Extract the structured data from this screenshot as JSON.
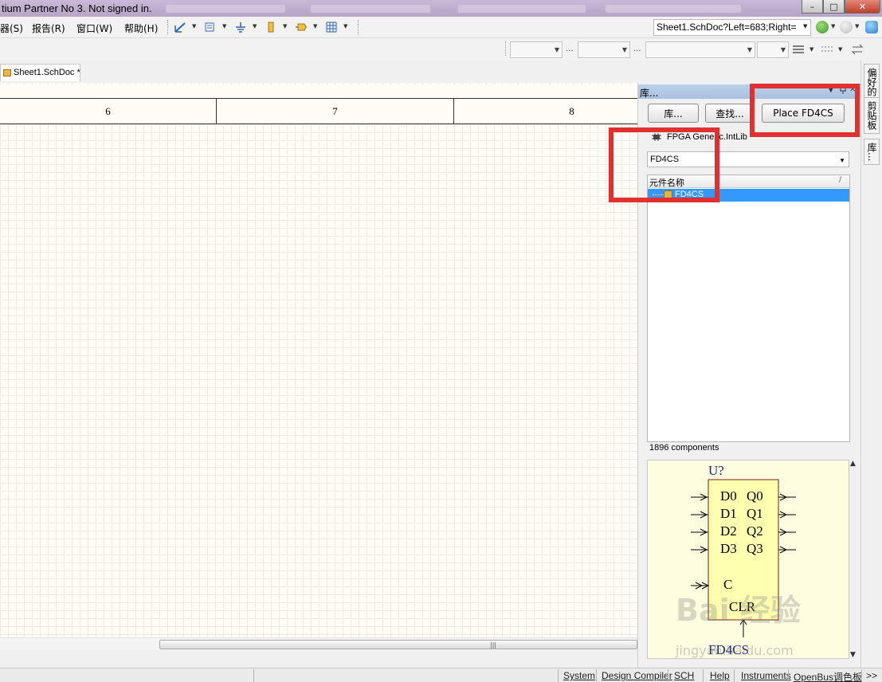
{
  "window": {
    "title": "tium Partner No 3. Not signed in.",
    "min_glyph": "–",
    "max_glyph": "□",
    "close_glyph": "✕"
  },
  "menu": {
    "items": [
      "器(S)",
      "报告(R)",
      "窗口(W)",
      "帮助(H)"
    ]
  },
  "address": {
    "value": "Sheet1.SchDoc?Left=683;Right="
  },
  "toolbar2": {
    "ellipsis": "..."
  },
  "document_tab": {
    "label": "Sheet1.SchDoc *"
  },
  "sheet_border": {
    "zones": [
      "6",
      "7",
      "8"
    ]
  },
  "library_panel": {
    "title": "库...",
    "buttons": {
      "libraries": "库...",
      "search": "查找...",
      "place": "Place FD4CS"
    },
    "current_library": "FPGA Generic.IntLib",
    "filter_value": "FD4CS",
    "column_header": "元件名称",
    "sort_glyph": "/",
    "components": [
      "FD4CS"
    ],
    "component_count": "1896 components",
    "preview": {
      "designator": "U?",
      "comment": "FD4CS",
      "pins_left": [
        "D0",
        "D1",
        "D2",
        "D3",
        "C"
      ],
      "pins_right": [
        "Q0",
        "Q1",
        "Q2",
        "Q3"
      ],
      "bottom_pin": "CLR"
    }
  },
  "side_tabs": [
    "偏好的",
    "剪贴板",
    "库..."
  ],
  "statusbar": {
    "items": [
      "System",
      "Design Compiler",
      "SCH",
      "Help",
      "Instruments",
      "OpenBus调色板"
    ],
    "more": ">>"
  },
  "watermark": {
    "main": "Bai 经验",
    "sub": "jingyan.baidu.com"
  },
  "colors": {
    "highlight": "#e0302f",
    "selection": "#3399ff",
    "canvas": "#fffbf5",
    "preview_bg": "#fffde0"
  }
}
